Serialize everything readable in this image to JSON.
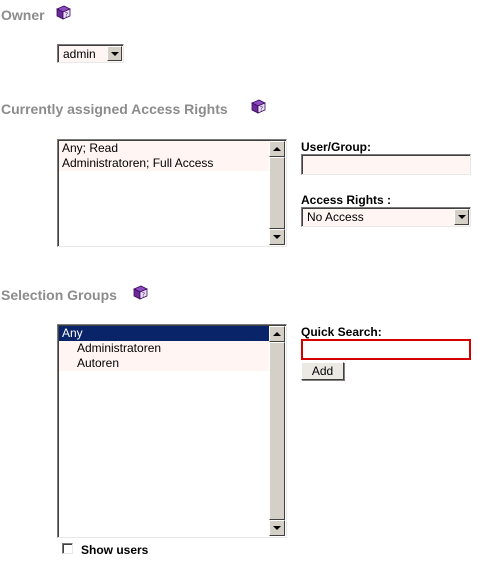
{
  "owner": {
    "title": "Owner",
    "help_icon": "book-help-icon",
    "selected": "admin"
  },
  "access_rights": {
    "title": "Currently assigned Access Rights",
    "help_icon": "book-help-icon",
    "items": [
      "Any; Read",
      "Administratoren; Full Access"
    ],
    "user_group_label": "User/Group:",
    "user_group_value": "",
    "rights_label": "Access Rights :",
    "rights_selected": "No Access"
  },
  "selection_groups": {
    "title": "Selection Groups",
    "help_icon": "book-help-icon",
    "items": [
      "Any",
      "Administratoren",
      "Autoren"
    ],
    "selected_index": 0,
    "quick_search_label": "Quick Search:",
    "quick_search_value": "",
    "add_label": "Add",
    "show_users_label": "Show users",
    "show_users_checked": false
  },
  "colors": {
    "section_title": "#8c8c8c",
    "field_bg": "#fff5f2",
    "selection": "#0a246a",
    "focus_border": "#d40000",
    "icon": "#6a2a9a"
  }
}
